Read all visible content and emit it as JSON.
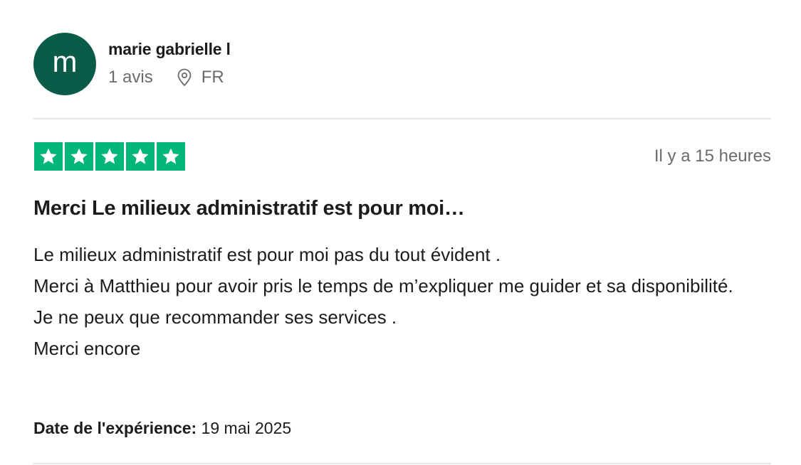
{
  "reviewer": {
    "avatar_letter": "m",
    "avatar_color": "#0a5b47",
    "name": "marie gabrielle l",
    "reviews_count": "1 avis",
    "location_icon": "location-pin-icon",
    "country": "FR"
  },
  "review": {
    "rating": 5,
    "max_rating": 5,
    "star_color": "#00b67a",
    "relative_date": "Il y a 15 heures",
    "title": "Merci Le milieux administratif est pour moi…",
    "body_lines": [
      "Le milieux administratif est pour moi pas du tout évident .",
      "Merci à Matthieu pour avoir pris le temps de m’expliquer me guider et sa disponibilité.",
      "Je ne peux que recommander ses services .",
      "Merci encore"
    ],
    "experience_label": "Date de l'expérience:",
    "experience_date": "19 mai 2025"
  }
}
